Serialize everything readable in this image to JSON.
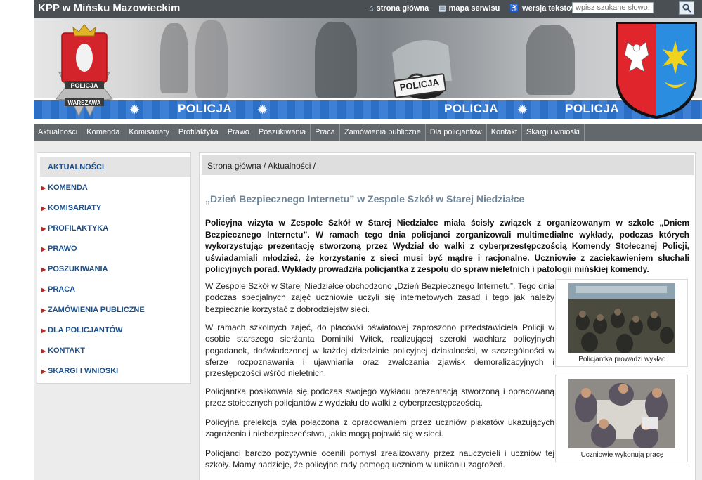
{
  "header": {
    "site_title": "KPP w Mińsku Mazowieckim",
    "links": [
      {
        "icon": "home-icon",
        "label": "strona główna"
      },
      {
        "icon": "sitemap-icon",
        "label": "mapa serwisu"
      },
      {
        "icon": "accessibility-icon",
        "label": "wersja tekstowa"
      }
    ],
    "search_placeholder": "wpisz szukane słowo..."
  },
  "banner": {
    "stripe_word": "POLICJA",
    "sign_text": "POLICJA",
    "logo_top_text": "POLICJA",
    "logo_bottom_text": "WARSZAWA"
  },
  "nav": [
    "Aktualności",
    "Komenda",
    "Komisariaty",
    "Profilaktyka",
    "Prawo",
    "Poszukiwania",
    "Praca",
    "Zamówienia publiczne",
    "Dla policjantów",
    "Kontakt",
    "Skargi i wnioski"
  ],
  "sidebar": {
    "active": "AKTUALNOŚCI",
    "items": [
      "KOMENDA",
      "KOMISARIATY",
      "PROFILAKTYKA",
      "PRAWO",
      "POSZUKIWANIA",
      "PRACA",
      "ZAMÓWIENIA PUBLICZNE",
      "DLA POLICJANTÓW",
      "KONTAKT",
      "SKARGI I WNIOSKI"
    ]
  },
  "article": {
    "breadcrumb": "Strona główna / Aktualności /",
    "title": "„Dzień Bezpiecznego Internetu” w Zespole Szkół w Starej Niedziałce",
    "lead": "Policyjna wizyta w Zespole Szkół w Starej Niedziałce miała ścisły związek z organizowanym w szkole „Dniem Bezpiecznego Internetu”. W ramach tego dnia policjanci zorganizowali multimedialne wykłady, podczas których wykorzystując prezentację stworzoną przez Wydział do walki z cyberprzestępczością Komendy Stołecznej Policji, uświadamiali młodzież, że korzystanie z sieci musi być mądre i racjonalne. Uczniowie z zaciekawieniem słuchali policyjnych porad. Wykłady prowadziła policjantka z zespołu do spraw nieletnich i patologii mińskiej komendy.",
    "paragraphs": [
      "W Zespole Szkół w Starej Niedziałce obchodzono „Dzień Bezpiecznego Internetu”. Tego dnia podczas specjalnych zajęć uczniowie uczyli się internetowych zasad i tego jak należy bezpiecznie korzystać z dobrodziejstw sieci.",
      "W ramach szkolnych zajęć, do placówki oświatowej zaproszono przedstawiciela Policji w osobie starszego sierżanta Dominiki Witek, realizującej szeroki wachlarz policyjnych pogadanek, doświadczonej w każdej dziedzinie policyjnej działalności, w szczególności w sferze rozpoznawania i ujawniania oraz zwalczania zjawisk demoralizacyjnych i przestępczości wśród nieletnich.",
      "Policjantka posiłkowała się podczas swojego wykładu prezentacją stworzoną i opracowaną przez stołecznych policjantów z wydziału do walki z cyberprzestępczością.",
      "Policyjna prelekcja była połączona z opracowaniem przez uczniów plakatów ukazujących zagrożenia i niebezpieczeństwa, jakie mogą pojawić się w sieci.",
      "Policjanci bardzo pozytywnie ocenili pomysł zrealizowany przez nauczycieli i uczniów tej szkoły. Mamy nadzieję, że policyjne rady pomogą uczniom w unikaniu zagrożeń."
    ],
    "figures": [
      {
        "caption": "Policjantka prowadzi wykład"
      },
      {
        "caption": "Uczniowie wykonują pracę"
      }
    ]
  }
}
